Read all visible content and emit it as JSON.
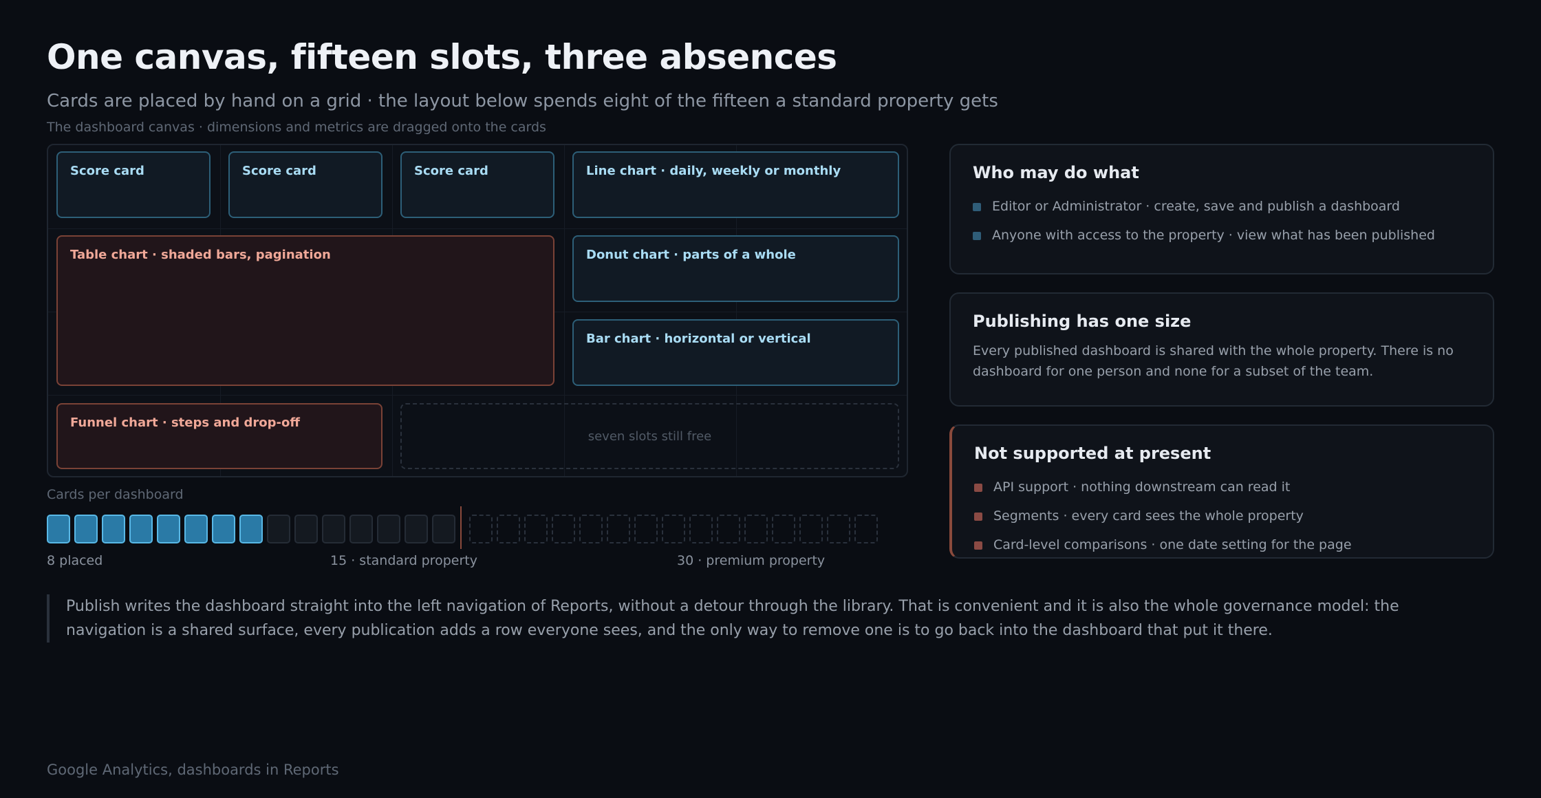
{
  "header": {
    "title": "One canvas, fifteen slots, three absences",
    "subtitle": "Cards are placed by hand on a grid · the layout below spends eight of the fifteen a standard property gets",
    "canvas_caption": "The dashboard canvas · dimensions and metrics are dragged onto the cards"
  },
  "canvas": {
    "cards": [
      "Score card",
      "Score card",
      "Score card",
      "Line chart · daily, weekly or monthly",
      "Table chart · shaded bars, pagination",
      "Donut chart · parts of a whole",
      "Bar chart · horizontal or vertical",
      "Funnel chart · steps and drop-off"
    ],
    "free_slots_label": "seven slots still free"
  },
  "tally": {
    "caption": "Cards per dashboard",
    "placed": 8,
    "standard": 15,
    "premium": 30,
    "label_placed": "8 placed",
    "label_standard": "15 · standard property",
    "label_premium": "30 · premium property"
  },
  "panels": {
    "roles": {
      "title": "Who may do what",
      "items": [
        "Editor or Administrator · create, save and publish a dashboard",
        "Anyone with access to the property · view what has been published"
      ]
    },
    "publishing": {
      "title": "Publishing has one size",
      "body": "Every published dashboard is shared with the whole property. There is no dashboard for one person and none for a subset of the team."
    },
    "unsupported": {
      "title": "Not supported at present",
      "items": [
        "API support · nothing downstream can read it",
        "Segments · every card sees the whole property",
        "Card-level comparisons · one date setting for the page"
      ]
    }
  },
  "quote": "Publish writes the dashboard straight into the left navigation of Reports, without a detour through the library. That is convenient and it is also the whole governance model: the navigation is a shared surface, every publication adds a row everyone sees, and the only way to remove one is to go back into the dashboard that put it there.",
  "footer": "Google Analytics, dashboards in Reports",
  "colors": {
    "background": "#0a0d13",
    "card_cool_border": "#2d5f78",
    "card_cool_text": "#a9dcf4",
    "card_warm_border": "#7a4236",
    "card_warm_text": "#f0a898",
    "slot_placed": "#2a7aa6",
    "divider": "#8a4a3c"
  }
}
